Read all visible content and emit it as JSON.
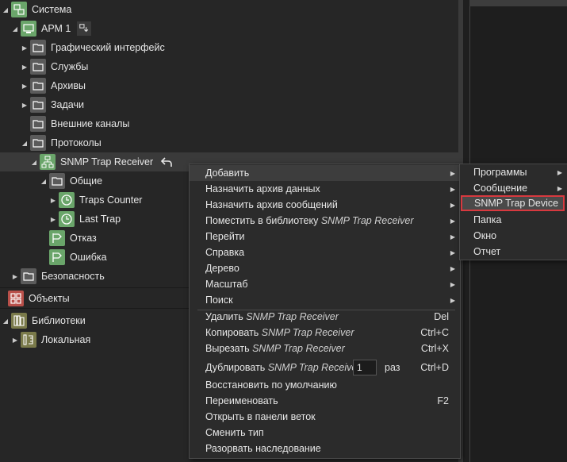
{
  "tree": {
    "items": [
      {
        "label": "Система",
        "icon": "system-icon"
      },
      {
        "label": "АРМ 1",
        "icon": "workstation-icon"
      },
      {
        "label": "Графический интерфейс",
        "icon": "folder-icon"
      },
      {
        "label": "Службы",
        "icon": "folder-icon"
      },
      {
        "label": "Архивы",
        "icon": "folder-icon"
      },
      {
        "label": "Задачи",
        "icon": "folder-icon"
      },
      {
        "label": "Внешние каналы",
        "icon": "folder-icon"
      },
      {
        "label": "Протоколы",
        "icon": "folder-icon"
      },
      {
        "label": "SNMP Trap Receiver",
        "icon": "snmp-icon"
      },
      {
        "label": "Общие",
        "icon": "folder-icon"
      },
      {
        "label": "Traps Counter",
        "icon": "clock-icon"
      },
      {
        "label": "Last Trap",
        "icon": "clock-icon"
      },
      {
        "label": "Отказ",
        "icon": "flag-icon"
      },
      {
        "label": "Ошибка",
        "icon": "flag-icon"
      },
      {
        "label": "Безопасность",
        "icon": "folder-icon"
      }
    ],
    "objects": "Объекты",
    "libraries": "Библиотеки",
    "local": "Локальная"
  },
  "context_menu": {
    "add": "Добавить",
    "assign_data_archive": "Назначить архив данных",
    "assign_message_archive": "Назначить архив сообщений",
    "place_in_library_prefix": "Поместить в библиотеку",
    "goto": "Перейти",
    "help": "Справка",
    "tree": "Дерево",
    "scale": "Масштаб",
    "search": "Поиск",
    "delete_prefix": "Удалить",
    "delete_shortcut": "Del",
    "copy_prefix": "Копировать",
    "copy_shortcut": "Ctrl+C",
    "cut_prefix": "Вырезать",
    "cut_shortcut": "Ctrl+X",
    "duplicate_prefix": "Дублировать",
    "duplicate_count": "1",
    "duplicate_unit": "раз",
    "duplicate_shortcut": "Ctrl+D",
    "restore_default": "Восстановить по умолчанию",
    "rename": "Переименовать",
    "rename_shortcut": "F2",
    "open_in_branch_panel": "Открыть в панели веток",
    "change_type": "Сменить тип",
    "break_inheritance": "Разорвать наследование",
    "target_name": "SNMP Trap Receiver"
  },
  "submenu": {
    "programs": "Программы",
    "message": "Сообщение",
    "snmp_trap_device": "SNMP Trap Device",
    "folder": "Папка",
    "window": "Окно",
    "report": "Отчет"
  },
  "colors": {
    "highlight_border": "#d8393f",
    "green_icon": "#6aa56a",
    "red_icon": "#b9504a"
  }
}
